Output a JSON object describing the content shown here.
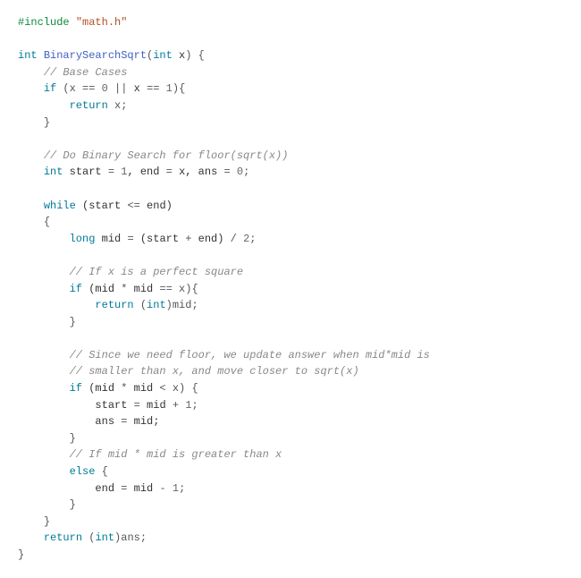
{
  "code": {
    "l01_pp": "#include",
    "l01_str": "\"math.h\"",
    "l03_kw1": "int",
    "l03_fn": "BinarySearchSqrt",
    "l03_p1": "(",
    "l03_kw2": "int",
    "l03_id": " x",
    "l03_p2": ") {",
    "l04_cmt": "// Base Cases",
    "l05_kw": "if",
    "l05_p1": " (x ",
    "l05_op1": "==",
    "l05_sp1": " ",
    "l05_n1": "0",
    "l05_sp2": " ",
    "l05_op2": "||",
    "l05_sp3": " x ",
    "l05_op3": "==",
    "l05_sp4": " ",
    "l05_n2": "1",
    "l05_p2": "){",
    "l06_kw": "return",
    "l06_rest": " x;",
    "l07_p": "}",
    "l09_cmt": "// Do Binary Search for floor(sqrt(x))",
    "l10_kw": "int",
    "l10_a": " start ",
    "l10_eq1": "=",
    "l10_sp1": " ",
    "l10_n1": "1",
    "l10_c1": ", end ",
    "l10_eq2": "=",
    "l10_c2": " x, ans ",
    "l10_eq3": "=",
    "l10_sp2": " ",
    "l10_n2": "0",
    "l10_sc": ";",
    "l12_kw": "while",
    "l12_p1": " (start ",
    "l12_op": "<=",
    "l12_p2": " end)",
    "l13_p": "{",
    "l14_kw": "long",
    "l14_a": " mid ",
    "l14_eq": "=",
    "l14_b": " (start ",
    "l14_op": "+",
    "l14_c": " end) ",
    "l14_div": "/",
    "l14_sp": " ",
    "l14_n": "2",
    "l14_sc": ";",
    "l16_cmt": "// If x is a perfect square",
    "l17_kw": "if",
    "l17_a": " (mid ",
    "l17_op1": "*",
    "l17_b": " mid ",
    "l17_op2": "==",
    "l17_c": " x){",
    "l18_kw": "return",
    "l18_sp": " (",
    "l18_cast": "int",
    "l18_rest": ")mid;",
    "l19_p": "}",
    "l21_cmt": "// Since we need floor, we update answer when mid*mid is",
    "l22_cmt": "// smaller than x, and move closer to sqrt(x)",
    "l23_kw": "if",
    "l23_a": " (mid ",
    "l23_op1": "*",
    "l23_b": " mid ",
    "l23_op2": "<",
    "l23_c": " x) {",
    "l24_a": "start ",
    "l24_eq": "=",
    "l24_b": " mid ",
    "l24_op": "+",
    "l24_sp": " ",
    "l24_n": "1",
    "l24_sc": ";",
    "l25_a": "ans ",
    "l25_eq": "=",
    "l25_b": " mid;",
    "l26_p": "}",
    "l27_cmt": "// If mid * mid is greater than x",
    "l28_kw": "else",
    "l28_p": " {",
    "l29_a": "end ",
    "l29_eq": "=",
    "l29_b": " mid ",
    "l29_op": "-",
    "l29_sp": " ",
    "l29_n": "1",
    "l29_sc": ";",
    "l30_p": "}",
    "l31_p": "}",
    "l32_kw": "return",
    "l32_sp": " (",
    "l32_cast": "int",
    "l32_rest": ")ans;",
    "l33_p": "}"
  }
}
